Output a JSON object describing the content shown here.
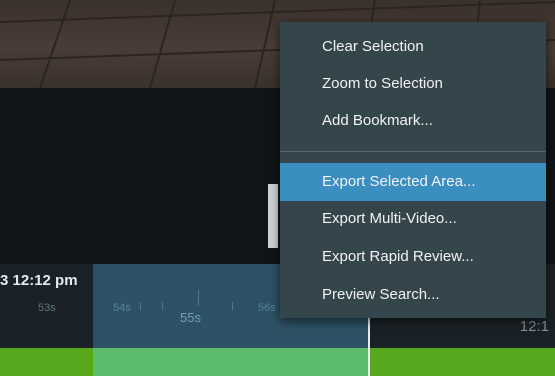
{
  "timeline": {
    "date_label": "3 12:12 pm",
    "tick_labels": [
      "53s",
      "54s",
      "55s",
      "56s"
    ],
    "end_time_label": "12:1"
  },
  "context_menu": {
    "items": [
      {
        "label": "Clear Selection",
        "highlighted": false
      },
      {
        "label": "Zoom to Selection",
        "highlighted": false
      },
      {
        "label": "Add Bookmark...",
        "highlighted": false
      },
      {
        "label": "Export Selected Area...",
        "highlighted": true
      },
      {
        "label": "Export Multi-Video...",
        "highlighted": false
      },
      {
        "label": "Export Rapid Review...",
        "highlighted": false
      },
      {
        "label": "Preview Search...",
        "highlighted": false
      }
    ]
  },
  "colors": {
    "menu_background": "#34454c",
    "menu_highlight": "#3a8ec0",
    "footage_bar": "#57a81c",
    "selection_overlay": "#4a96bc"
  }
}
